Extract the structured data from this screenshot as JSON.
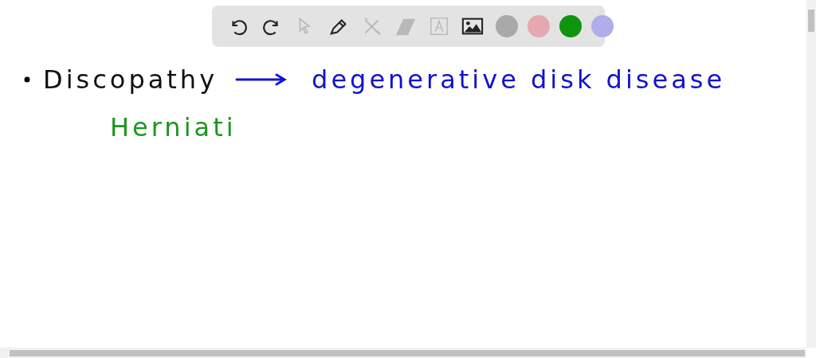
{
  "toolbar": {
    "tools": [
      {
        "kind": "undo",
        "disabled": false
      },
      {
        "kind": "redo",
        "disabled": false
      },
      {
        "kind": "pointer",
        "disabled": true
      },
      {
        "kind": "pen",
        "disabled": false
      },
      {
        "kind": "tools",
        "disabled": true
      },
      {
        "kind": "eraser",
        "disabled": true
      },
      {
        "kind": "text",
        "disabled": true
      },
      {
        "kind": "image",
        "disabled": false
      }
    ],
    "colors": [
      {
        "color": "#a9a9a9"
      },
      {
        "color": "#e6a8b0"
      },
      {
        "color": "#0f9410"
      },
      {
        "color": "#b1acea"
      }
    ]
  },
  "canvas": {
    "lines": [
      {
        "items": [
          {
            "kind": "bullet",
            "color": "#000000"
          },
          {
            "kind": "text",
            "text": "Discopathy",
            "color": "#111111"
          },
          {
            "kind": "arrow",
            "color": "#1414d6"
          },
          {
            "kind": "text",
            "text": "degenerative disk disease",
            "color": "#1212d0"
          }
        ]
      },
      {
        "items": [
          {
            "kind": "text",
            "text": "Herniati",
            "color": "#1e961e"
          }
        ]
      }
    ]
  }
}
